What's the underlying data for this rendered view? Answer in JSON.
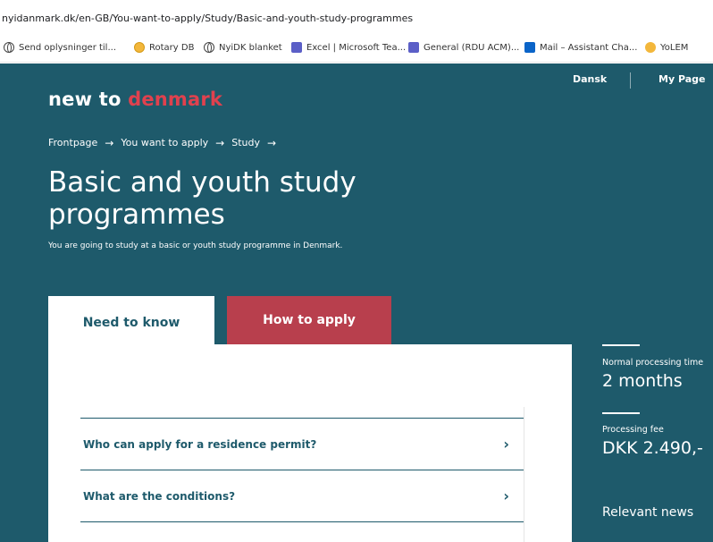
{
  "browser": {
    "url": "nyidanmark.dk/en-GB/You-want-to-apply/Study/Basic-and-youth-study-programmes",
    "bookmarks": [
      {
        "label": "Send oplysninger til...",
        "icon": "globe-icon"
      },
      {
        "label": "Rotary DB",
        "icon": "rotary-icon"
      },
      {
        "label": "NyiDK blanket",
        "icon": "globe-icon"
      },
      {
        "label": "Excel | Microsoft Tea...",
        "icon": "teams-icon"
      },
      {
        "label": "General (RDU ACM)...",
        "icon": "teams-icon"
      },
      {
        "label": "Mail – Assistant Cha...",
        "icon": "outlook-icon"
      },
      {
        "label": "YoLEM",
        "icon": "yolem-icon"
      }
    ]
  },
  "site": {
    "logo": {
      "part1": "new to ",
      "part2": "denmark"
    },
    "top_links": {
      "language": "Dansk",
      "account": "My Page"
    },
    "breadcrumb": [
      "Frontpage",
      "You want to apply",
      "Study"
    ],
    "breadcrumb_arrow": "→",
    "title": "Basic and youth study programmes",
    "subtitle": "You are going to study at a basic or youth study programme in Denmark.",
    "tabs": {
      "need_to_know": "Need to know",
      "how_to_apply": "How to apply"
    },
    "accordion": [
      {
        "question": "Who can apply for a residence permit?",
        "chevron": "›"
      },
      {
        "question": "What are the conditions?",
        "chevron": "›"
      }
    ],
    "sidebar": {
      "processing_time_label": "Normal processing time",
      "processing_time_value": "2 months",
      "fee_label": "Processing fee",
      "fee_value": "DKK 2.490,-",
      "news_heading": "Relevant news"
    },
    "colors": {
      "background": "#1e5a6b",
      "accent": "#e0414e",
      "tab_active_bg": "#b83f4d"
    }
  }
}
